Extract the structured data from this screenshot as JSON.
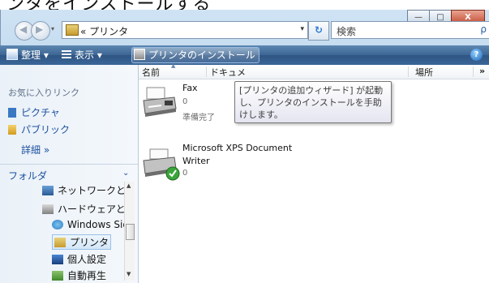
{
  "caption": "ンタをインストールする",
  "window": {
    "minimize_glyph": "—",
    "maximize_glyph": "□",
    "close_glyph": "X"
  },
  "address": {
    "path": "« プリンタ",
    "dropdown_glyph": "▾",
    "refresh_glyph": "↻",
    "search_placeholder": "検索",
    "search_glyph": "ρ"
  },
  "toolbar": {
    "organize": "整理 ▾",
    "views": "表示 ▾",
    "install_printer": "プリンタのインストール",
    "help_glyph": "?"
  },
  "left_pane": {
    "favorites_heading": "お気に入りリンク",
    "favorites": [
      "ピクチャ",
      "パブリック"
    ],
    "more": "詳細 »",
    "folders": "フォルダ",
    "folders_chev": "⌄",
    "tree": [
      "ネットワークと・",
      "ハードウェアと!",
      "Windows Side",
      "プリンタ",
      "個人設定",
      "自動再生"
    ]
  },
  "columns": {
    "name": "名前",
    "documents": "ドキュメ",
    "location": "場所",
    "more": "»"
  },
  "items": [
    {
      "name": "Fax",
      "count": "0",
      "status": "準備完了"
    },
    {
      "name_line1": "Microsoft XPS Document",
      "name_line2": "Writer",
      "count": "0"
    }
  ],
  "tooltip": {
    "lines": [
      "[プリンタの追加ウィザード] が起動",
      "し、プリンタのインストールを手助",
      "けします。"
    ]
  },
  "colors": {
    "toolbar": "#3d6593",
    "link": "#1b4f9e",
    "close_button": "#c24a2f"
  }
}
